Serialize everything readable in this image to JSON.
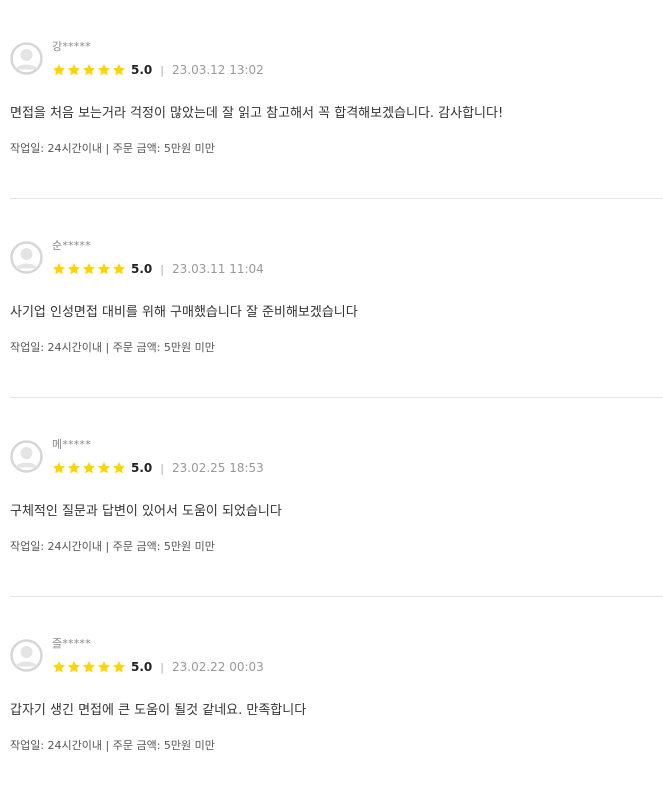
{
  "reviews": [
    {
      "nickname": "강*****",
      "score": "5.0",
      "separator": "|",
      "date": "23.03.12 13:02",
      "rating": 5,
      "text": "면접을 처음 보는거라 걱정이 많았는데 잘 읽고 참고해서 꼭 합격해보겠습니다. 감사합니다!",
      "meta": "작업일: 24시간이내 | 주문 금액: 5만원 미만"
    },
    {
      "nickname": "순*****",
      "score": "5.0",
      "separator": "|",
      "date": "23.03.11 11:04",
      "rating": 5,
      "text": "사기업 인성면접 대비를 위해 구매했습니다 잘 준비해보겠습니다",
      "meta": "작업일: 24시간이내 | 주문 금액: 5만원 미만"
    },
    {
      "nickname": "메*****",
      "score": "5.0",
      "separator": "|",
      "date": "23.02.25 18:53",
      "rating": 5,
      "text": "구체적인 질문과 답변이 있어서 도움이 되었습니다",
      "meta": "작업일: 24시간이내 | 주문 금액: 5만원 미만"
    },
    {
      "nickname": "즐*****",
      "score": "5.0",
      "separator": "|",
      "date": "23.02.22 00:03",
      "rating": 5,
      "text": "갑자기 생긴 면접에 큰 도움이 될것 같네요. 만족합니다",
      "meta": "작업일: 24시간이내 | 주문 금액: 5만원 미만"
    }
  ],
  "colors": {
    "star": "#ffd400",
    "avatar_ring": "#d6d6d6",
    "avatar_fill": "#e4e4e4",
    "divider": "#e6e6e6"
  },
  "icons": {
    "avatar": "default-user-avatar-icon",
    "star": "filled-star-icon"
  }
}
